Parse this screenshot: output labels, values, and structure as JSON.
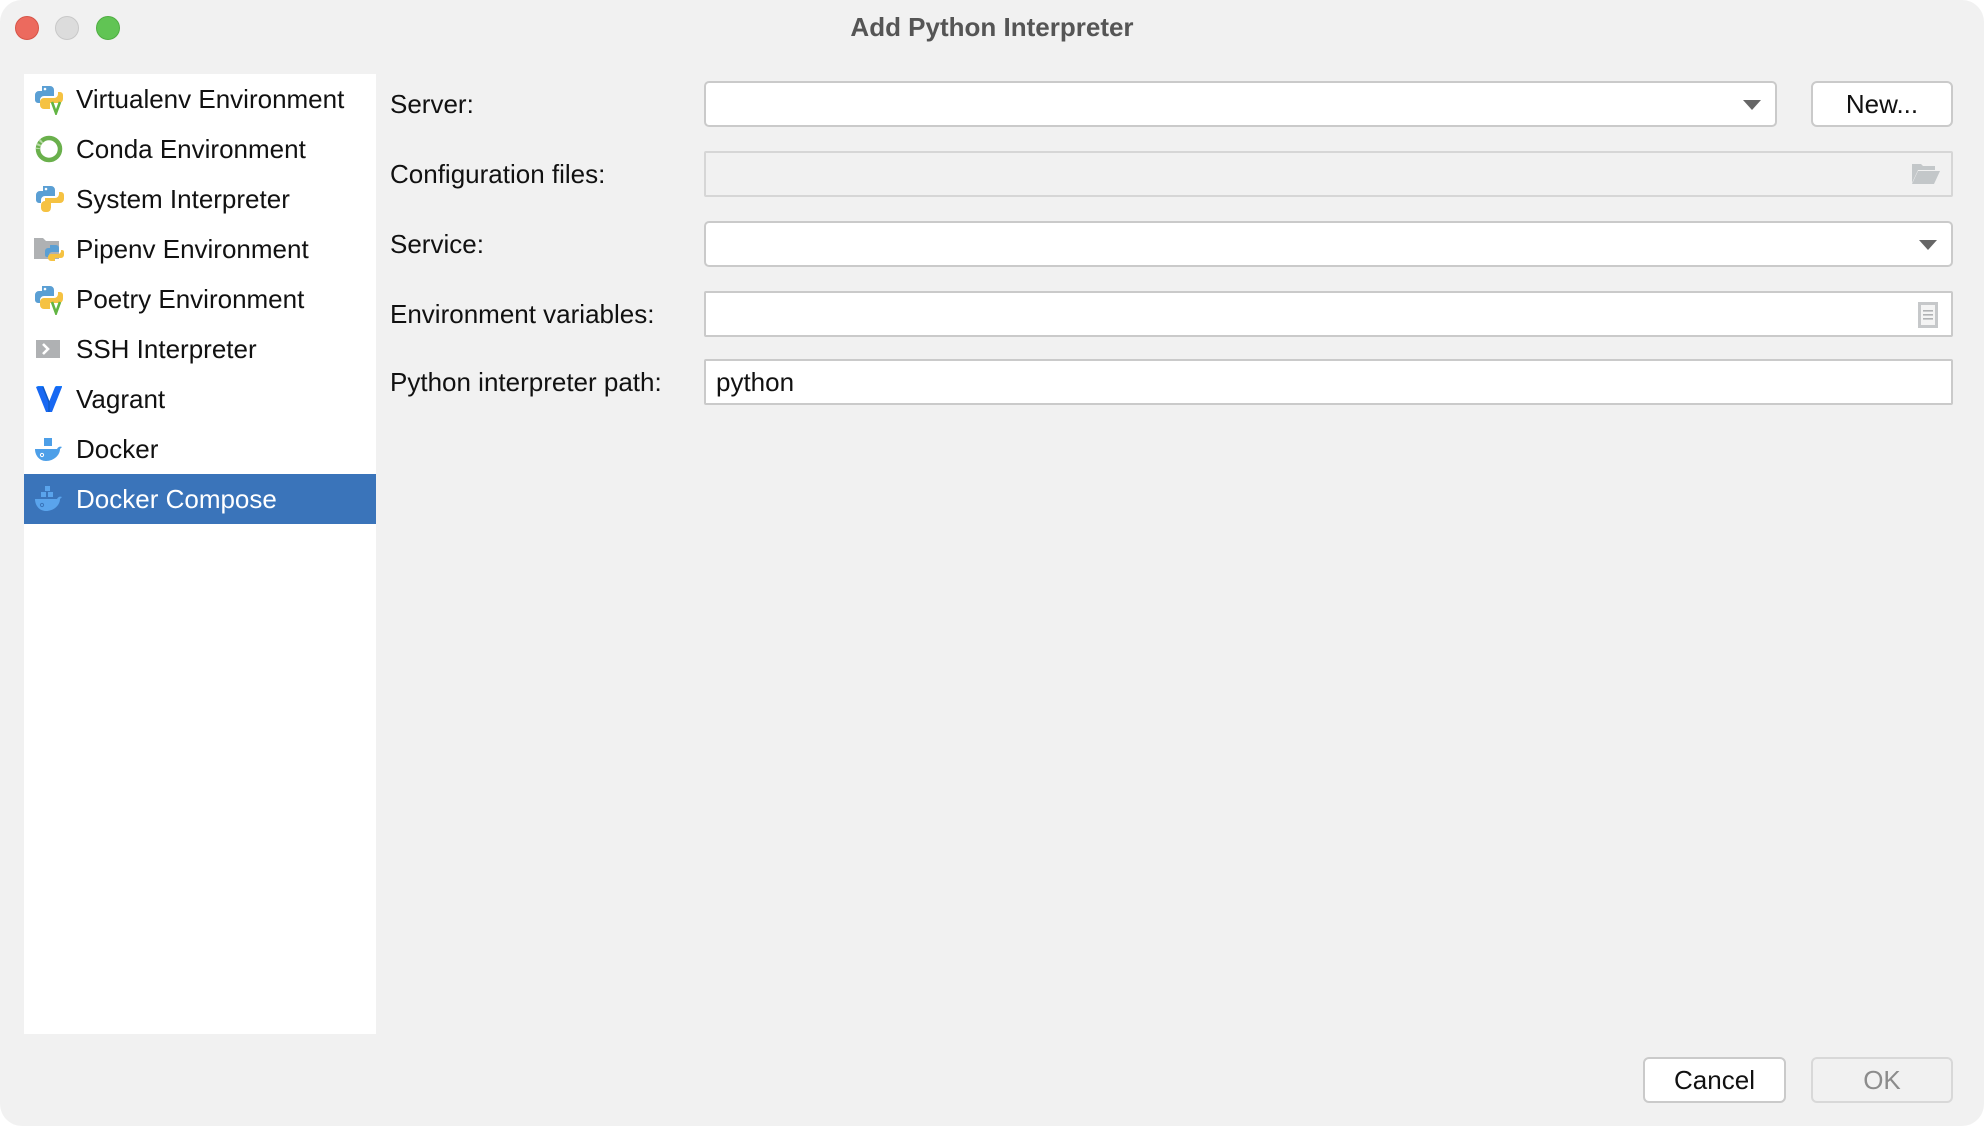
{
  "window": {
    "title": "Add Python Interpreter",
    "controls": [
      "close",
      "minimize",
      "maximize"
    ]
  },
  "sidebar": {
    "selected_index": 8,
    "items": [
      {
        "label": "Virtualenv Environment",
        "icon": "python-virtualenv-icon"
      },
      {
        "label": "Conda Environment",
        "icon": "conda-icon"
      },
      {
        "label": "System Interpreter",
        "icon": "python-icon"
      },
      {
        "label": "Pipenv Environment",
        "icon": "pipenv-icon"
      },
      {
        "label": "Poetry Environment",
        "icon": "python-poetry-icon"
      },
      {
        "label": "SSH Interpreter",
        "icon": "ssh-terminal-icon"
      },
      {
        "label": "Vagrant",
        "icon": "vagrant-icon"
      },
      {
        "label": "Docker",
        "icon": "docker-icon"
      },
      {
        "label": "Docker Compose",
        "icon": "docker-compose-icon"
      }
    ]
  },
  "form": {
    "server": {
      "label": "Server:",
      "value": "",
      "new_button": "New..."
    },
    "config_files": {
      "label": "Configuration files:",
      "value": "",
      "disabled": true
    },
    "service": {
      "label": "Service:",
      "value": ""
    },
    "env_vars": {
      "label": "Environment variables:",
      "value": ""
    },
    "interpreter_path": {
      "label": "Python interpreter path:",
      "value": "python"
    }
  },
  "footer": {
    "cancel": "Cancel",
    "ok": "OK",
    "ok_enabled": false
  },
  "colors": {
    "selection": "#3a74ba",
    "window_bg": "#f1f1f1"
  }
}
